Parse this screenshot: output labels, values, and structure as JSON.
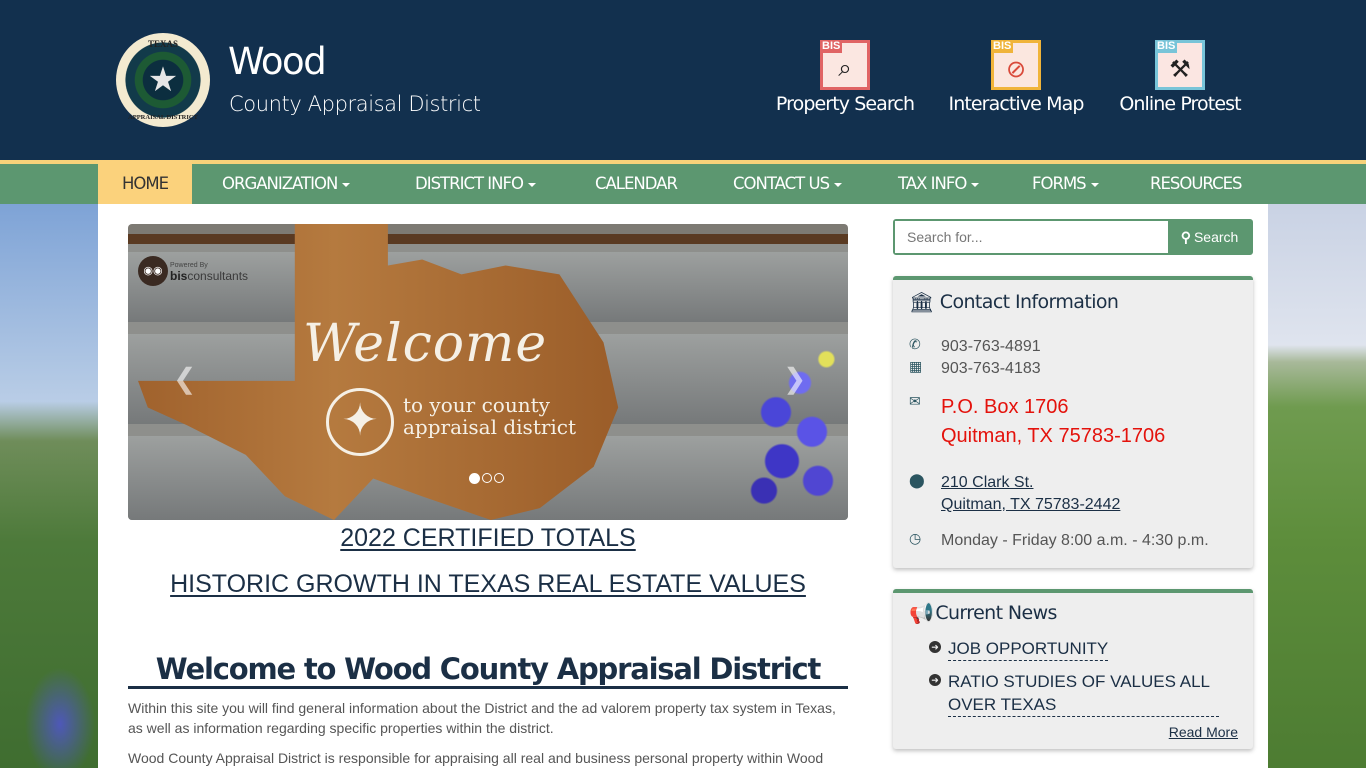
{
  "header": {
    "logo": {
      "top_text": "TEXAS",
      "bottom_text": "APPRAISAL DISTRICT"
    },
    "title": "Wood",
    "subtitle": "County Appraisal District",
    "quick_links": [
      {
        "label": "Property Search",
        "badge": "BIS",
        "icon": "house-magnifier-icon",
        "color": "#e06464"
      },
      {
        "label": "Interactive Map",
        "badge": "BIS",
        "icon": "map-compass-icon",
        "color": "#f0b43a"
      },
      {
        "label": "Online Protest",
        "badge": "BIS",
        "icon": "gavel-icon",
        "color": "#78c4d8"
      }
    ]
  },
  "nav": {
    "items": [
      {
        "label": "HOME",
        "active": true,
        "dropdown": false
      },
      {
        "label": "ORGANIZATION",
        "dropdown": true
      },
      {
        "label": "DISTRICT INFO",
        "dropdown": true
      },
      {
        "label": "CALENDAR",
        "dropdown": false
      },
      {
        "label": "CONTACT US",
        "dropdown": true
      },
      {
        "label": "TAX INFO",
        "dropdown": true
      },
      {
        "label": "FORMS",
        "dropdown": true
      },
      {
        "label": "RESOURCES",
        "dropdown": false
      }
    ]
  },
  "carousel": {
    "powered_by": "Powered By",
    "brand_bold": "bis",
    "brand_rest": "consultants",
    "slide_title": "Welcome",
    "slide_sub_1": "to your county",
    "slide_sub_2": "appraisal district",
    "slide_count": 3,
    "active_slide": 1
  },
  "main": {
    "links": [
      "2022 CERTIFIED TOTALS",
      "HISTORIC GROWTH IN TEXAS REAL ESTATE VALUES"
    ],
    "heading": "Welcome to Wood County Appraisal District",
    "paragraphs": [
      "Within this site you will find general information about the District and the ad valorem property tax system in Texas, as well as information regarding specific properties within the district.",
      "Wood County Appraisal District is responsible for appraising all real and business personal property within Wood"
    ]
  },
  "sidebar": {
    "search": {
      "placeholder": "Search for...",
      "value": "",
      "button_label": "Search"
    },
    "contact": {
      "title": "Contact Information",
      "phone": "903-763-4891",
      "fax": "903-763-4183",
      "mail_line1": "P.O. Box 1706",
      "mail_line2": "Quitman, TX 75783-1706",
      "address_line1": "210 Clark St.",
      "address_line2": "Quitman, TX 75783-2442",
      "hours": "Monday - Friday 8:00 a.m. - 4:30 p.m."
    },
    "news": {
      "title": "Current News",
      "items": [
        "JOB OPPORTUNITY",
        "RATIO STUDIES OF VALUES ALL OVER TEXAS"
      ],
      "read_more": "Read More"
    }
  },
  "colors": {
    "header_bg": "#12304e",
    "nav_green": "#5c9770",
    "nav_active": "#fbd27c",
    "accent_red": "#e4120c",
    "text_navy": "#1b2f45"
  }
}
